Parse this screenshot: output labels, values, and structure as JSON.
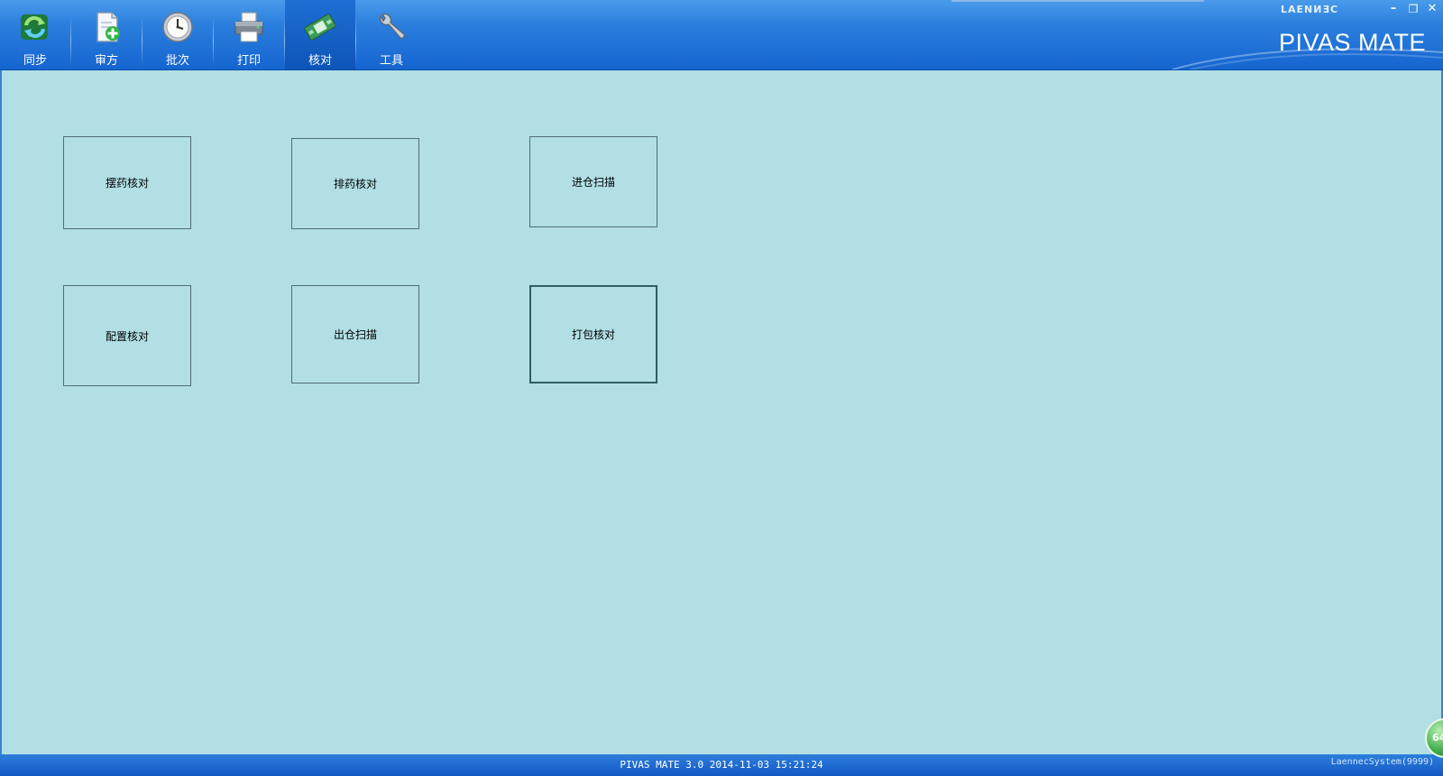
{
  "toolbar": {
    "items": [
      {
        "label": "同步",
        "icon": "sync-icon"
      },
      {
        "label": "审方",
        "icon": "review-prescription-icon"
      },
      {
        "label": "批次",
        "icon": "batch-clock-icon"
      },
      {
        "label": "打印",
        "icon": "printer-icon"
      },
      {
        "label": "核对",
        "icon": "check-icon",
        "active": true
      },
      {
        "label": "工具",
        "icon": "wrench-icon"
      }
    ]
  },
  "branding": {
    "company": "LAENИƎC",
    "product": "PIVAS MATE"
  },
  "window_controls": {
    "minimize": "–",
    "restore": "❐",
    "close": "✕"
  },
  "tiles": [
    {
      "label": "摆药核对"
    },
    {
      "label": "排药核对"
    },
    {
      "label": "进仓扫描"
    },
    {
      "label": "配置核对"
    },
    {
      "label": "出仓扫描"
    },
    {
      "label": "打包核对",
      "focused": true
    }
  ],
  "status": {
    "version_text": "PIVAS MATE 3.0 2014-11-03 15:21:24",
    "user_text": "LaennecSystem(9999)",
    "badge": "64"
  },
  "colors": {
    "header": "#1565d0",
    "content_bg": "#b1dfe4",
    "tile_border": "#4f6e72"
  }
}
